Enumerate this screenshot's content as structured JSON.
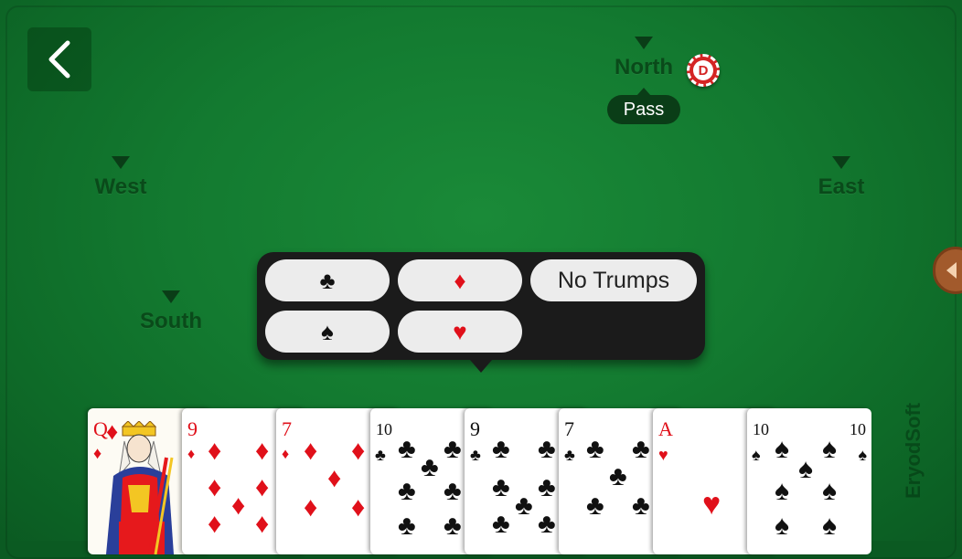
{
  "back_button": {
    "icon": "chevron-left-icon"
  },
  "seats": {
    "north": "North",
    "west": "West",
    "east": "East",
    "south": "South"
  },
  "dealer_chip": {
    "letter": "D"
  },
  "north_bid": "Pass",
  "trump_selector": {
    "clubs": "♣",
    "diamonds": "♦",
    "no_trumps": "No Trumps",
    "spades": "♠",
    "hearts": "♥"
  },
  "hand": [
    {
      "rank": "Q",
      "suit": "♦",
      "color": "#e0101a"
    },
    {
      "rank": "9",
      "suit": "♦",
      "color": "#e0101a"
    },
    {
      "rank": "7",
      "suit": "♦",
      "color": "#e0101a"
    },
    {
      "rank": "10",
      "suit": "♣",
      "color": "#111111"
    },
    {
      "rank": "9",
      "suit": "♣",
      "color": "#111111"
    },
    {
      "rank": "7",
      "suit": "♣",
      "color": "#111111"
    },
    {
      "rank": "A",
      "suit": "♥",
      "color": "#e0101a"
    },
    {
      "rank": "10",
      "suit": "♠",
      "color": "#111111"
    }
  ],
  "watermark": "EryodSoft",
  "colors": {
    "felt": "#137a30",
    "seat_label": "#0a4a1a",
    "panel": "#1b1b1b",
    "red_suit": "#e0101a"
  }
}
